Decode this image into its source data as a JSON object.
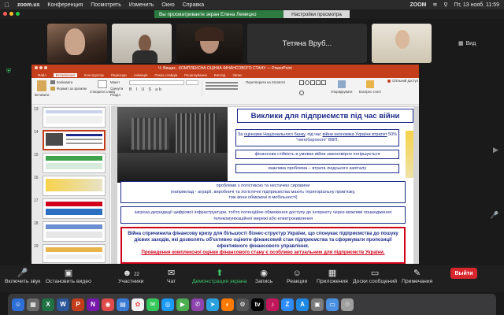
{
  "menubar": {
    "app": "zoom.us",
    "items": [
      "Конференция",
      "Посмотреть",
      "Изменить",
      "Окно",
      "Справка"
    ],
    "zoom_label": "ZOOM",
    "datetime": "Пт, 13 нояб.  11:59"
  },
  "share_banner": {
    "message": "Вы просматриваете экран Елена Лемицко",
    "view_options": "Настройки просмотра"
  },
  "gallery": {
    "name_tile": "Тетяна Вруб...",
    "view_label": "Вид"
  },
  "ppt": {
    "title": "Ч: Вищих.. КОМПЛЕКСНА ОЦІНКА ФІНАНСОВОГО СТАНУ — PowerPoint",
    "tabs": [
      "Файл",
      "Вставлення",
      "Конструктор",
      "Переходи",
      "Анімація",
      "Показ слайдів",
      "Рецензування",
      "Вигляд",
      "Запис"
    ],
    "ribbon": {
      "paste": "Вставити",
      "copy": "Копіювати",
      "format": "Формат за зразком",
      "new_slide": "Створити слайд",
      "layout": "Макет",
      "reset": "Скинути",
      "section": "Розділ",
      "convert": "Перетворити на SmartArt",
      "arrange": "Упорядкувати",
      "quick_styles": "Експрес-стилі",
      "share": "Спільний доступ"
    },
    "thumb_numbers": [
      "13",
      "14",
      "15",
      "16",
      "17",
      "18",
      "19"
    ],
    "slide": {
      "title": "Виклики для підприємств під час війни",
      "b1_pre": "За ",
      "b1_link1": "оцінками Національного банку",
      "b1_mid": ", під час ",
      "b1_link2": "війни економіка України втратит",
      "b1_post": " 50% \"непобороного\" ВВП.",
      "b2": "фінансова стійкість в умовах війни закономірно погіршується",
      "b3": "важлива проблема – втрата людського капіталу",
      "b4_l1": "проблеми з логістикою та нестачею сировини",
      "b4_l2": "(наприклад - аграрії, виробничі та логістичні підприємства мають територіальну прив'язку,",
      "b4_l3": "тож вони обмежені в мобільності)",
      "b5": "загроза деградації цифрової інфраструктури, тобто потенційне обмеження доступу до інтернету через можливі пошкодження телекомунікаційної мережі або електрокивлення",
      "b6_main": "Війна спричинила фінансову кризу для більшості бізнес-структур України, що спонукає підприємства до пошуку дієвих заходів, які дозволять об'єктивно оцінити фінансовий стан підприємства та сформувати пропозиції ефективного фінансового управління.",
      "b6_red": "Проведення комплексної оцінки фінансового стану є особливо актуальним для підприємств України."
    }
  },
  "toolbar": {
    "mute": "Включить звук",
    "video": "Остановить видео",
    "participants": "Участники",
    "participants_count": "22",
    "chat": "Чат",
    "share": "Демонстрация экрана",
    "record": "Запись",
    "reactions": "Реакции",
    "apps": "Приложения",
    "whiteboards": "Доски сообщений",
    "notes": "Примечания",
    "end": "Выйти"
  },
  "colors": {
    "ppt_accent": "#c43e1c",
    "banner_green": "#2c7a3f",
    "slide_text": "#1d2b8a",
    "slide_red": "#d0021b",
    "end_red": "#d9272e"
  }
}
